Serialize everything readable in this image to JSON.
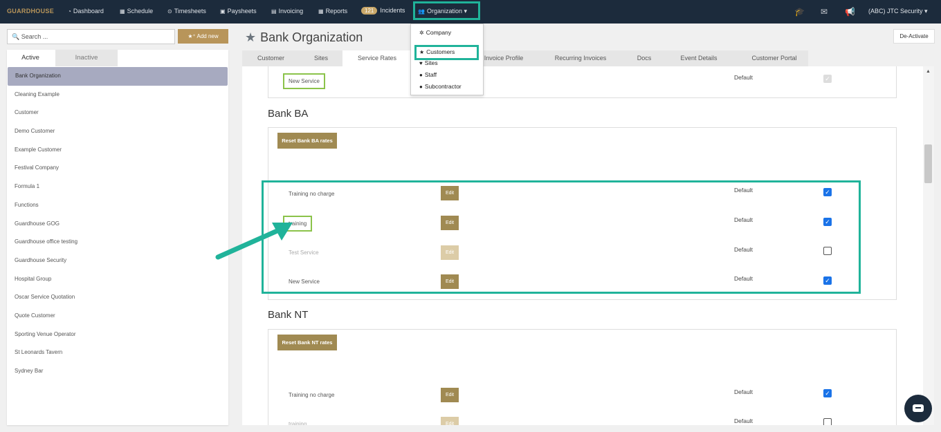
{
  "nav": {
    "logo": "GUARDHOUSE",
    "items": [
      {
        "icon": "dashboard-icon",
        "glyph": "🎨",
        "label": "Dashboard"
      },
      {
        "icon": "calendar-icon",
        "glyph": "▦",
        "label": "Schedule"
      },
      {
        "icon": "clock-icon",
        "glyph": "⊙",
        "label": "Timesheets"
      },
      {
        "icon": "money-icon",
        "glyph": "▣",
        "label": "Paysheets"
      },
      {
        "icon": "invoice-icon",
        "glyph": "▤",
        "label": "Invoicing"
      },
      {
        "icon": "reports-icon",
        "glyph": "▦",
        "label": "Reports"
      },
      {
        "icon": "incidents-badge",
        "glyph": "121",
        "label": "Incidents"
      },
      {
        "icon": "users-icon",
        "glyph": "👥",
        "label": "Organization ▾"
      }
    ],
    "right_icons": [
      "graduation-cap-icon",
      "envelope-icon",
      "bullhorn-icon"
    ],
    "account": "(ABC) JTC Security ▾"
  },
  "org_dropdown": {
    "items": [
      {
        "icon": "gear-icon",
        "glyph": "✲",
        "label": "Company"
      },
      {
        "icon": "star-icon",
        "glyph": "★",
        "label": "Customers"
      },
      {
        "icon": "map-marker-icon",
        "glyph": "♥",
        "label": "Sites"
      },
      {
        "icon": "user-icon",
        "glyph": "●",
        "label": "Staff"
      },
      {
        "icon": "user-icon",
        "glyph": "●",
        "label": "Subcontractor"
      }
    ]
  },
  "sidebar": {
    "search_placeholder": "Search ...",
    "add_new": "★⁺ Add new",
    "tab_active": "Active",
    "tab_inactive": "Inactive",
    "customers": [
      "Bank Organization",
      "Cleaning Example",
      "Customer",
      "Demo Customer",
      "Example Customer",
      "Festival Company",
      "Formula 1",
      "Functions",
      "Guardhouse GOG",
      "Guardhouse office testing",
      "Guardhouse Security",
      "Hospital Group",
      "Oscar Service Quotation",
      "Quote Customer",
      "Sporting Venue Operator",
      "St Leonards Tavern",
      "Sydney Bar"
    ],
    "selected_index": 0
  },
  "main": {
    "title": "Bank Organization",
    "deactivate": "De-Activate",
    "tabs": [
      "Customer",
      "Sites",
      "Service Rates",
      "Invoice Profile",
      "Recurring Invoices",
      "Docs",
      "Event Details",
      "Customer Portal"
    ],
    "top_panel": {
      "service": "New Service",
      "default": "Default"
    },
    "sections": [
      {
        "title": "Bank BA",
        "reset": "Reset Bank BA rates",
        "rows": [
          {
            "name": "Training no charge",
            "edit": "Edit",
            "default": "Default",
            "checked": true,
            "disabled": false
          },
          {
            "name": "training",
            "edit": "Edit",
            "default": "Default",
            "checked": true,
            "disabled": false
          },
          {
            "name": "Test Service",
            "edit": "Edit",
            "default": "Default",
            "checked": false,
            "disabled": true
          },
          {
            "name": "New Service",
            "edit": "Edit",
            "default": "Default",
            "checked": true,
            "disabled": false
          }
        ]
      },
      {
        "title": "Bank NT",
        "reset": "Reset Bank NT rates",
        "rows": [
          {
            "name": "Training no charge",
            "edit": "Edit",
            "default": "Default",
            "checked": true,
            "disabled": false
          },
          {
            "name": "training",
            "edit": "Edit",
            "default": "Default",
            "checked": false,
            "disabled": true
          }
        ]
      }
    ]
  },
  "colors": {
    "nav_bg": "#1c2b3c",
    "accent": "#b8955a",
    "highlight": "#20b39a",
    "checkbox": "#1a73e8"
  }
}
